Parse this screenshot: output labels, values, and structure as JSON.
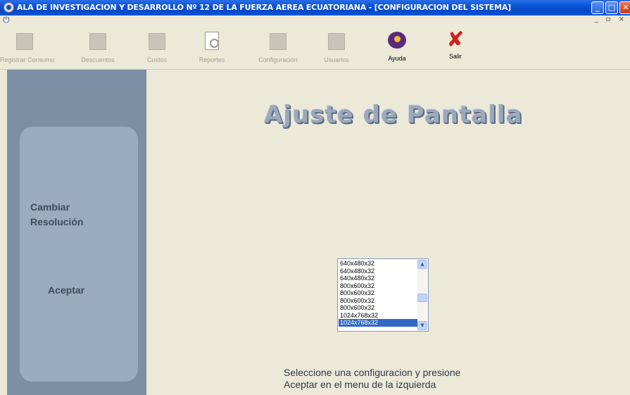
{
  "window": {
    "title": "ALA DE INVESTIGACION Y DESARROLLO Nº 12 DE LA FUERZA AEREA ECUATORIANA - [CONFIGURACION DEL SISTEMA]",
    "minimize_glyph": "_",
    "maximize_glyph": "□",
    "close_glyph": "✕"
  },
  "menubar": {
    "app_icon": "power-icon",
    "mdi_controls": "_ ▫ ×"
  },
  "toolbar": {
    "buttons": [
      {
        "label": "Registrar Consumo",
        "icon": "consumption-icon",
        "enabled": false
      },
      {
        "label": "Descuentos",
        "icon": "discount-icon",
        "enabled": false
      },
      {
        "label": "Costos",
        "icon": "costs-icon",
        "enabled": false
      },
      {
        "label": "Reportes",
        "icon": "report-magnifier-icon",
        "enabled": false
      },
      {
        "label": "Configuración",
        "icon": "configuration-icon",
        "enabled": false
      },
      {
        "label": "Usuarios",
        "icon": "users-icon",
        "enabled": false
      },
      {
        "label": "Ayuda",
        "icon": "help-book-icon",
        "enabled": true
      },
      {
        "label": "Salir",
        "icon": "exit-x-icon",
        "enabled": true
      }
    ]
  },
  "sidebar": {
    "change_resolution_line1": "Cambiar",
    "change_resolution_line2": "Resolución",
    "accept": "Aceptar"
  },
  "main": {
    "heading": "Ajuste de Pantalla",
    "resolutions": [
      "640x480x32",
      "640x480x32",
      "640x480x32",
      "800x600x32",
      "800x600x32",
      "800x600x32",
      "800x600x32",
      "1024x768x32",
      "1024x768x32"
    ],
    "selected_index": 8,
    "instructions_line1": "Seleccione una configuracion y presione",
    "instructions_line2": "Aceptar en el menu de la izquierda"
  },
  "colors": {
    "titlebar": "#0a52d6",
    "background": "#ece9d8",
    "sidebar": "#7c90a5",
    "sidebar_panel": "#9aacbf",
    "selection": "#316ac5"
  }
}
